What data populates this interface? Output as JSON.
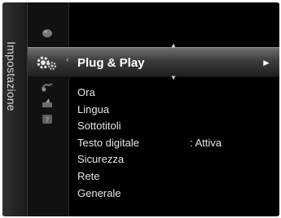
{
  "colors": {
    "background": "#000000",
    "text": "#e6e6e6",
    "highlight_bar": "#4a4a4a"
  },
  "sidebar": {
    "vertical_title": "Impostazione",
    "icons": [
      "picture-icon",
      "setup-gear-icon",
      "input-icon",
      "application-icon",
      "support-icon"
    ]
  },
  "selected": {
    "label": "Plug & Play",
    "right_arrow": "►"
  },
  "menu": {
    "items": [
      {
        "label": "Ora"
      },
      {
        "label": "Lingua"
      },
      {
        "label": "Sottotitoli"
      },
      {
        "label": "Testo digitale",
        "value": ": Attiva"
      },
      {
        "label": "Sicurezza"
      },
      {
        "label": "Rete"
      },
      {
        "label": "Generale"
      }
    ]
  }
}
